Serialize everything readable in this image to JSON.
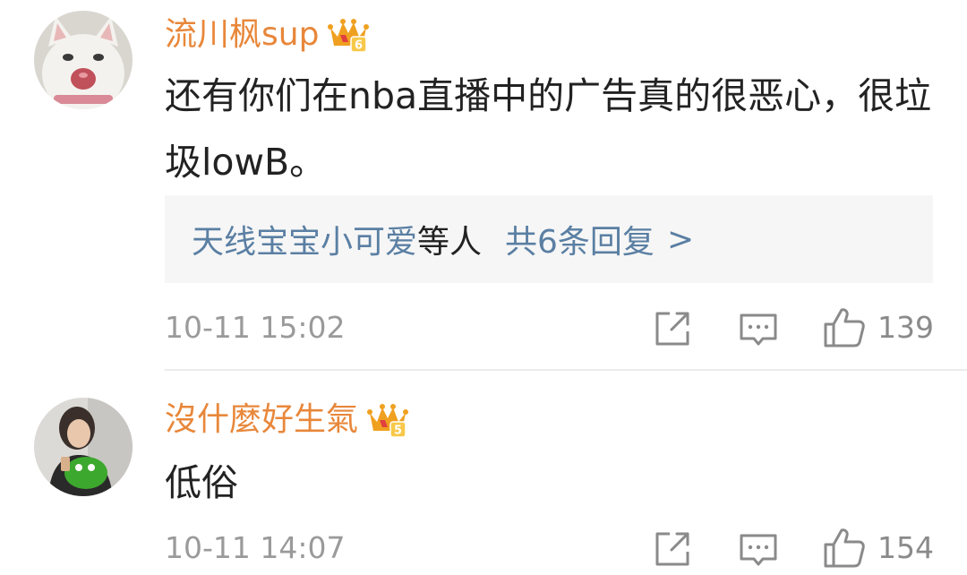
{
  "comments": [
    {
      "username": "流川枫sup",
      "vip_level": "6",
      "text": "还有你们在nba直播中的广告真的很恶心，很垃圾lowB。",
      "replies": {
        "names": "天线宝宝小可爱",
        "suffix": "等人",
        "count_text": "共6条回复",
        "arrow": ">"
      },
      "timestamp": "10-11 15:02",
      "likes": "139",
      "icons": [
        "share-icon",
        "comment-icon",
        "like-icon"
      ]
    },
    {
      "username": "沒什麼好生氣",
      "vip_level": "5",
      "text": "低俗",
      "timestamp": "10-11 14:07",
      "likes": "154",
      "icons": [
        "share-icon",
        "comment-icon",
        "like-icon"
      ]
    }
  ],
  "colors": {
    "username": "#e8873a",
    "link": "#5a7fa3",
    "meta": "#9a9a9a",
    "reply_bg": "#f6f6f6",
    "badge": "#f0a020"
  }
}
